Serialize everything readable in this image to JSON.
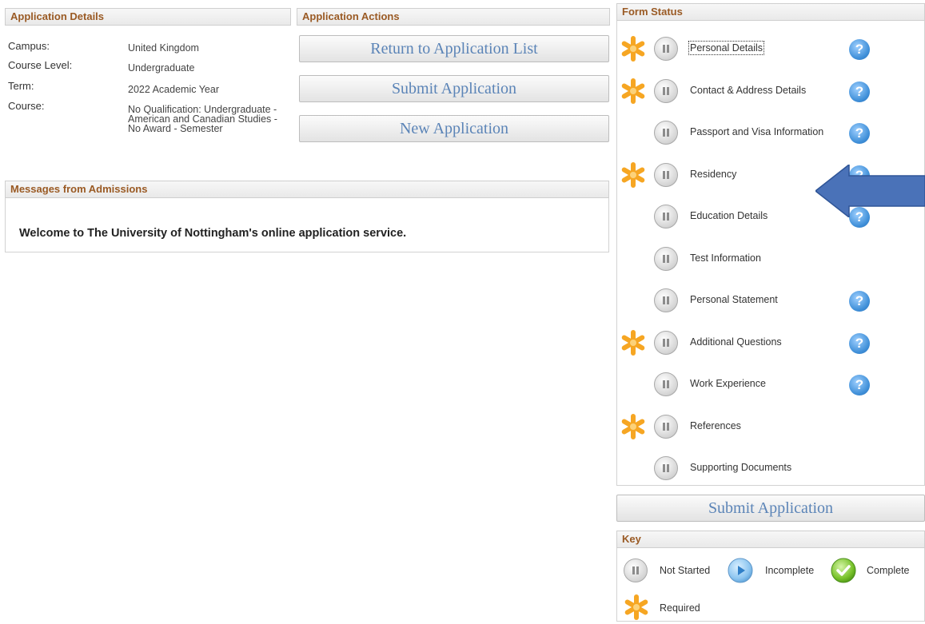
{
  "app_details": {
    "heading": "Application Details",
    "fields": [
      {
        "label": "Campus:",
        "value": "United Kingdom"
      },
      {
        "label": "Course Level:",
        "value": "Undergraduate"
      },
      {
        "label": "Term:",
        "value": "2022 Academic Year"
      },
      {
        "label": "Course:",
        "value_lines": [
          "No Qualification: Undergraduate -",
          "American and Canadian Studies -",
          "No Award - Semester"
        ]
      }
    ]
  },
  "app_actions": {
    "heading": "Application Actions",
    "return_label": "Return to Application List",
    "submit_label": "Submit Application",
    "new_label": "New Application"
  },
  "messages": {
    "heading": "Messages from Admissions",
    "welcome": "Welcome to The University of Nottingham's online application service."
  },
  "form_status": {
    "heading": "Form Status",
    "items": [
      {
        "label": "Personal Details",
        "required": true,
        "help": true,
        "status": "not-started"
      },
      {
        "label": "Contact & Address Details",
        "required": true,
        "help": true,
        "status": "not-started"
      },
      {
        "label": "Passport and Visa Information",
        "required": false,
        "help": true,
        "status": "not-started"
      },
      {
        "label": "Residency",
        "required": true,
        "help": true,
        "status": "not-started"
      },
      {
        "label": "Education Details",
        "required": false,
        "help": true,
        "status": "not-started"
      },
      {
        "label": "Test Information",
        "required": false,
        "help": false,
        "status": "not-started"
      },
      {
        "label": "Personal Statement",
        "required": false,
        "help": true,
        "status": "not-started"
      },
      {
        "label": "Additional Questions",
        "required": true,
        "help": true,
        "status": "not-started"
      },
      {
        "label": "Work Experience",
        "required": false,
        "help": true,
        "status": "not-started"
      },
      {
        "label": "References",
        "required": true,
        "help": false,
        "status": "not-started"
      },
      {
        "label": "Supporting Documents",
        "required": false,
        "help": false,
        "status": "not-started"
      }
    ],
    "help_glyph": "?",
    "submit_label": "Submit Application"
  },
  "key": {
    "heading": "Key",
    "not_started": "Not Started",
    "incomplete": "Incomplete",
    "complete": "Complete",
    "required": "Required"
  },
  "colors": {
    "heading_text": "#9a5a24",
    "button_text": "#5b84b7",
    "arrow": "#4a72b8",
    "star": "#f6a623",
    "help": "#3f8fd8",
    "complete": "#69b61f"
  },
  "icons": {
    "required": "asterisk-icon",
    "not_started": "pause-icon",
    "incomplete": "play-icon",
    "complete": "check-icon",
    "help": "question-icon",
    "pointer": "left-arrow-icon"
  }
}
